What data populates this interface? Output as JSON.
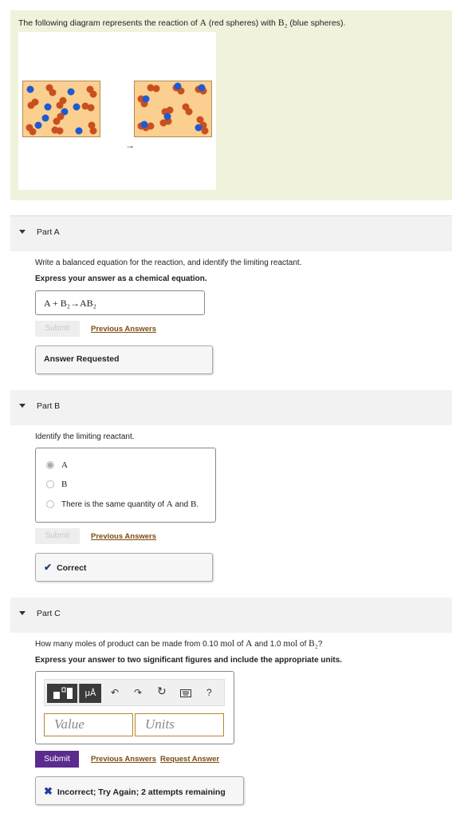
{
  "intro": {
    "text_pre": "The following diagram represents the reaction of ",
    "species_a": "A",
    "text_mid": " (red spheres) with ",
    "species_b2": "B₂",
    "text_post": " (blue spheres)."
  },
  "diagram": {
    "arrow": "→"
  },
  "part_a": {
    "title": "Part A",
    "question": "Write a balanced equation for the reaction, and identify the limiting reactant.",
    "instruction": "Express your answer as a chemical equation.",
    "answer_value": "A + B₂→AB₂",
    "submit_label": "Submit",
    "previous_answers_label": "Previous Answers",
    "feedback": "Answer Requested"
  },
  "part_b": {
    "title": "Part B",
    "question": "Identify the limiting reactant.",
    "options": [
      {
        "label": "A",
        "selected": true
      },
      {
        "label": "B",
        "selected": false
      },
      {
        "label_pre": "There is the same quantity of ",
        "label_a": "A",
        "label_and": " and ",
        "label_b": "B",
        "label_end": ".",
        "selected": false
      }
    ],
    "submit_label": "Submit",
    "previous_answers_label": "Previous Answers",
    "feedback_icon": "checkmark-icon",
    "feedback": "Correct"
  },
  "part_c": {
    "title": "Part C",
    "q_pre": "How many moles of product can be made from 0.10 ",
    "q_mol1": "mol",
    "q_of1": " of ",
    "q_a": "A",
    "q_and": " and 1.0 ",
    "q_mol2": "mol",
    "q_of2": " of ",
    "q_b2": "B₂",
    "q_end": "?",
    "instruction": "Express your answer to two significant figures and include the appropriate units.",
    "toolbar": {
      "units_button": "μÅ",
      "help": "?"
    },
    "value_placeholder": "Value",
    "units_placeholder": "Units",
    "submit_label": "Submit",
    "previous_answers_label": "Previous Answers",
    "request_answer_label": "Request Answer",
    "feedback_icon": "x-icon",
    "feedback": "Incorrect; Try Again; 2 attempts remaining"
  },
  "colors": {
    "red_sphere": "#c8501e",
    "blue_sphere": "#1e5ad2",
    "box_fill": "#fbcf8f",
    "submit": "#5b2b8f",
    "link": "#7b4b10"
  }
}
